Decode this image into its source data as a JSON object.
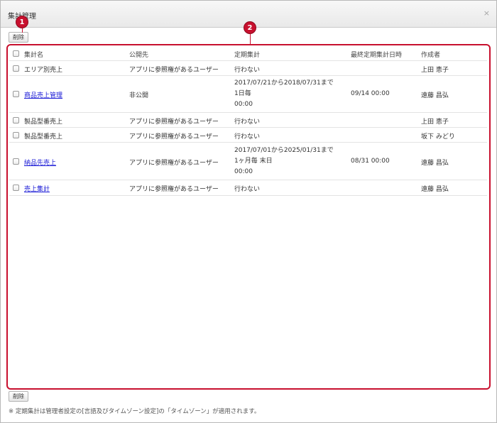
{
  "dialog": {
    "title": "集計管理",
    "close_glyph": "×"
  },
  "toolbar": {
    "delete_label": "削除"
  },
  "callouts": {
    "first": "1",
    "second": "2"
  },
  "table": {
    "headers": {
      "name": "集計名",
      "visibility": "公開先",
      "schedule": "定期集計",
      "last_run": "最終定期集計日時",
      "author": "作成者"
    },
    "rows": [
      {
        "name": "エリア別売上",
        "is_link": false,
        "visibility": "アプリに参照権があるユーザー",
        "schedule": [
          "行わない"
        ],
        "last_run": "",
        "author": "上田 恵子"
      },
      {
        "name": "商品売上管理",
        "is_link": true,
        "visibility": "非公開",
        "schedule": [
          "2017/07/21から2018/07/31まで",
          "1日毎",
          "00:00"
        ],
        "last_run": "09/14 00:00",
        "author": "遠藤 昌弘"
      },
      {
        "name": "製品型番売上",
        "is_link": false,
        "visibility": "アプリに参照権があるユーザー",
        "schedule": [
          "行わない"
        ],
        "last_run": "",
        "author": "上田 恵子"
      },
      {
        "name": "製品型番売上",
        "is_link": false,
        "visibility": "アプリに参照権があるユーザー",
        "schedule": [
          "行わない"
        ],
        "last_run": "",
        "author": "坂下 みどり"
      },
      {
        "name": "納品先売上",
        "is_link": true,
        "visibility": "アプリに参照権があるユーザー",
        "schedule": [
          "2017/07/01から2025/01/31まで",
          "1ヶ月毎 末日",
          "00:00"
        ],
        "last_run": "08/31 00:00",
        "author": "遠藤 昌弘"
      },
      {
        "name": "売上集計",
        "is_link": true,
        "visibility": "アプリに参照権があるユーザー",
        "schedule": [
          "行わない"
        ],
        "last_run": "",
        "author": "遠藤 昌弘"
      }
    ]
  },
  "footer": {
    "note": "※ 定期集計は管理者設定の[言語及びタイムゾーン設定]の「タイムゾーン」が適用されます。"
  },
  "colors": {
    "accent": "#c8102e",
    "link": "#1a1ad6"
  }
}
